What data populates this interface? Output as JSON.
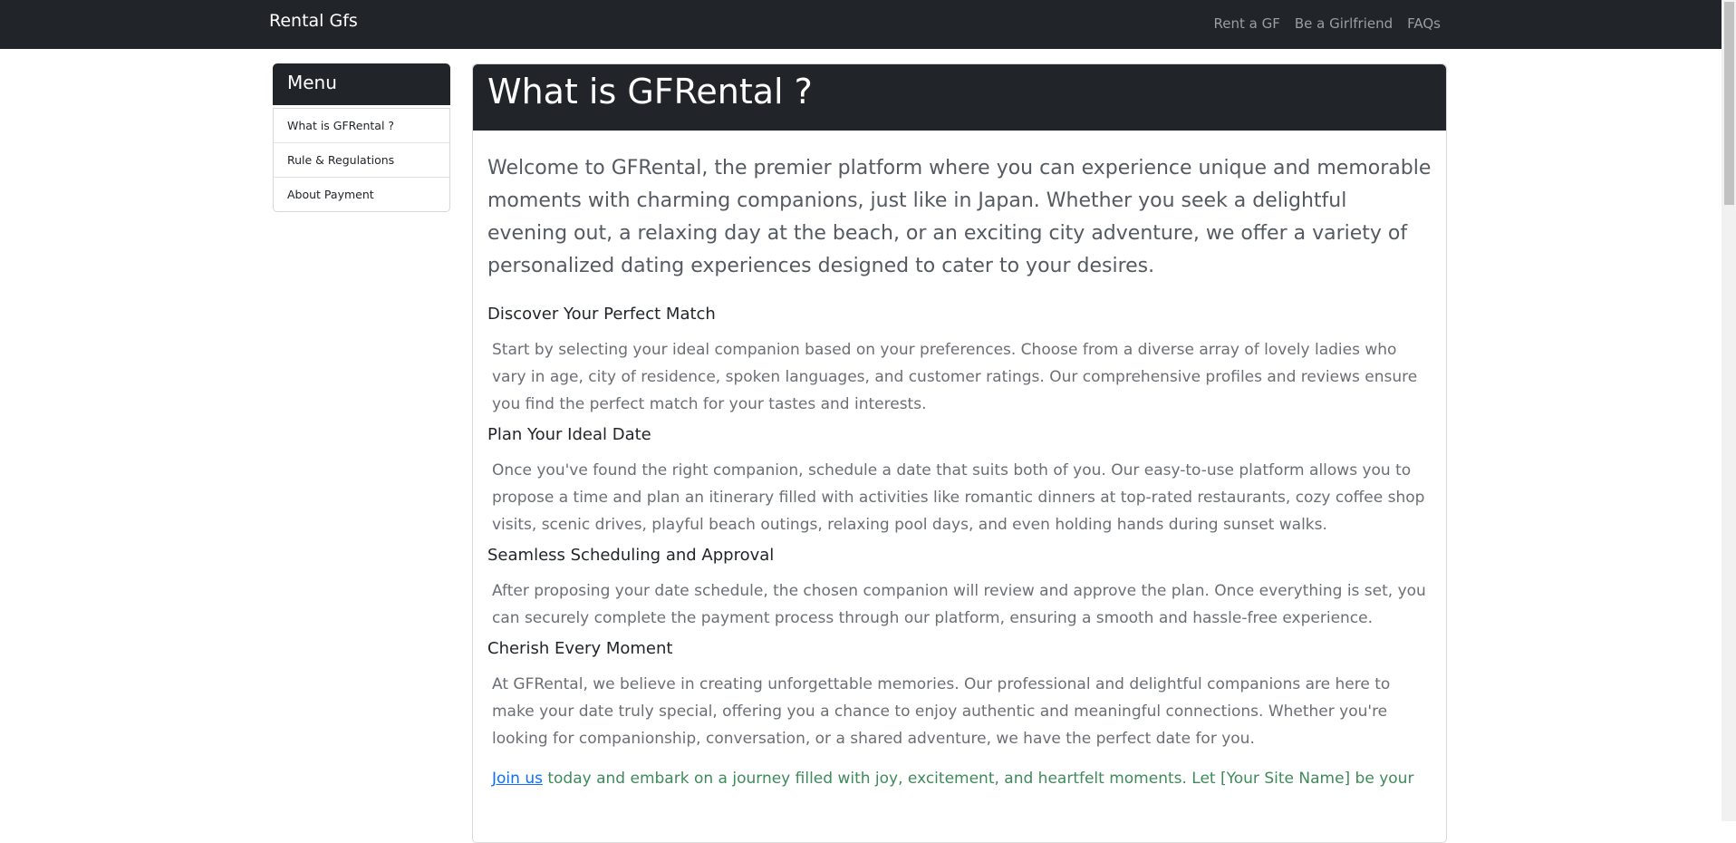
{
  "navbar": {
    "brand": "Rental Gfs",
    "links": [
      "Rent a GF",
      "Be a Girlfriend",
      "FAQs"
    ]
  },
  "sidebar": {
    "title": "Menu",
    "items": [
      "What is GFRental ?",
      "Rule & Regulations",
      "About Payment"
    ]
  },
  "main": {
    "title": "What is GFRental ?",
    "intro": "Welcome to GFRental, the premier platform where you can experience unique and memorable moments with charming companions, just like in Japan. Whether you seek a delightful evening out, a relaxing day at the beach, or an exciting city adventure, we offer a variety of personalized dating experiences designed to cater to your desires.",
    "sections": [
      {
        "heading": "Discover Your Perfect Match",
        "text": "Start by selecting your ideal companion based on your preferences. Choose from a diverse array of lovely ladies who vary in age, city of residence, spoken languages, and customer ratings. Our comprehensive profiles and reviews ensure you find the perfect match for your tastes and interests."
      },
      {
        "heading": "Plan Your Ideal Date",
        "text": "Once you've found the right companion, schedule a date that suits both of you. Our easy-to-use platform allows you to propose a time and plan an itinerary filled with activities like romantic dinners at top-rated restaurants, cozy coffee shop visits, scenic drives, playful beach outings, relaxing pool days, and even holding hands during sunset walks."
      },
      {
        "heading": "Seamless Scheduling and Approval",
        "text": "After proposing your date schedule, the chosen companion will review and approve the plan. Once everything is set, you can securely complete the payment process through our platform, ensuring a smooth and hassle-free experience."
      },
      {
        "heading": "Cherish Every Moment",
        "text": "At GFRental, we believe in creating unforgettable memories. Our professional and delightful companions are here to make your date truly special, offering you a chance to enjoy authentic and meaningful connections. Whether you're looking for companionship, conversation, or a shared adventure, we have the perfect date for you."
      }
    ],
    "join_link": "Join us",
    "join_text": " today and embark on a journey filled with joy, excitement, and heartfelt moments. Let [Your Site Name] be your"
  }
}
